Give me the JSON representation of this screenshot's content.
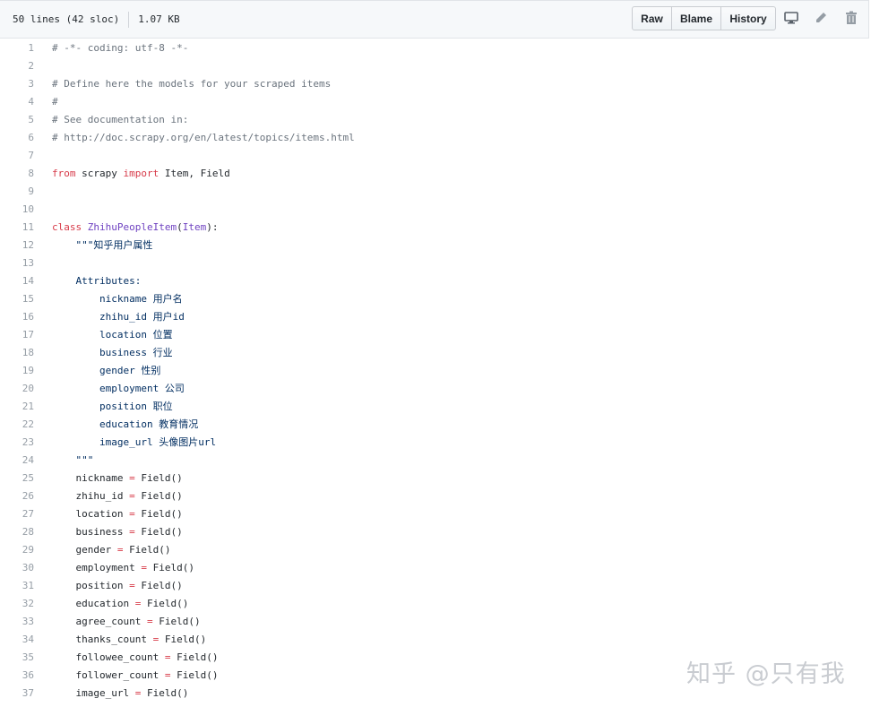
{
  "file_info": {
    "lines": "50 lines (42 sloc)",
    "size": "1.07 KB"
  },
  "buttons": {
    "raw": "Raw",
    "blame": "Blame",
    "history": "History"
  },
  "icons": {
    "desktop": "desktop-icon",
    "edit": "pencil-icon",
    "delete": "trash-icon"
  },
  "colors": {
    "comment": "#6a737d",
    "keyword": "#d73a49",
    "class": "#6f42c1",
    "builtin": "#005cc5",
    "line_number": "#959da5"
  },
  "watermark": "知乎 @只有我",
  "code_lines": [
    {
      "n": "1",
      "tokens": [
        {
          "t": "# -*- coding: utf-8 -*-",
          "c": "comment"
        }
      ]
    },
    {
      "n": "2",
      "tokens": []
    },
    {
      "n": "3",
      "tokens": [
        {
          "t": "# Define here the models for your scraped items",
          "c": "comment"
        }
      ]
    },
    {
      "n": "4",
      "tokens": [
        {
          "t": "#",
          "c": "comment"
        }
      ]
    },
    {
      "n": "5",
      "tokens": [
        {
          "t": "# See documentation in:",
          "c": "comment"
        }
      ]
    },
    {
      "n": "6",
      "tokens": [
        {
          "t": "# http://doc.scrapy.org/en/latest/topics/items.html",
          "c": "comment"
        }
      ]
    },
    {
      "n": "7",
      "tokens": []
    },
    {
      "n": "8",
      "tokens": [
        {
          "t": "from",
          "c": "keyword"
        },
        {
          "t": " scrapy ",
          "c": ""
        },
        {
          "t": "import",
          "c": "keyword"
        },
        {
          "t": " Item, Field",
          "c": ""
        }
      ]
    },
    {
      "n": "9",
      "tokens": []
    },
    {
      "n": "10",
      "tokens": []
    },
    {
      "n": "11",
      "tokens": [
        {
          "t": "class",
          "c": "keyword"
        },
        {
          "t": " ",
          "c": ""
        },
        {
          "t": "ZhihuPeopleItem",
          "c": "class"
        },
        {
          "t": "(",
          "c": ""
        },
        {
          "t": "Item",
          "c": "class"
        },
        {
          "t": "):",
          "c": ""
        }
      ]
    },
    {
      "n": "12",
      "tokens": [
        {
          "t": "    \"\"\"知乎用户属性",
          "c": "string"
        }
      ]
    },
    {
      "n": "13",
      "tokens": []
    },
    {
      "n": "14",
      "tokens": [
        {
          "t": "    Attributes:",
          "c": "string"
        }
      ]
    },
    {
      "n": "15",
      "tokens": [
        {
          "t": "        nickname 用户名",
          "c": "string"
        }
      ]
    },
    {
      "n": "16",
      "tokens": [
        {
          "t": "        zhihu_id 用户id",
          "c": "string"
        }
      ]
    },
    {
      "n": "17",
      "tokens": [
        {
          "t": "        location 位置",
          "c": "string"
        }
      ]
    },
    {
      "n": "18",
      "tokens": [
        {
          "t": "        business 行业",
          "c": "string"
        }
      ]
    },
    {
      "n": "19",
      "tokens": [
        {
          "t": "        gender 性别",
          "c": "string"
        }
      ]
    },
    {
      "n": "20",
      "tokens": [
        {
          "t": "        employment 公司",
          "c": "string"
        }
      ]
    },
    {
      "n": "21",
      "tokens": [
        {
          "t": "        position 职位",
          "c": "string"
        }
      ]
    },
    {
      "n": "22",
      "tokens": [
        {
          "t": "        education 教育情况",
          "c": "string"
        }
      ]
    },
    {
      "n": "23",
      "tokens": [
        {
          "t": "        image_url 头像图片url",
          "c": "string"
        }
      ]
    },
    {
      "n": "24",
      "tokens": [
        {
          "t": "    \"\"\"",
          "c": "string"
        }
      ]
    },
    {
      "n": "25",
      "tokens": [
        {
          "t": "    nickname ",
          "c": ""
        },
        {
          "t": "=",
          "c": "op"
        },
        {
          "t": " Field()",
          "c": ""
        }
      ]
    },
    {
      "n": "26",
      "tokens": [
        {
          "t": "    zhihu_id ",
          "c": ""
        },
        {
          "t": "=",
          "c": "op"
        },
        {
          "t": " Field()",
          "c": ""
        }
      ]
    },
    {
      "n": "27",
      "tokens": [
        {
          "t": "    location ",
          "c": ""
        },
        {
          "t": "=",
          "c": "op"
        },
        {
          "t": " Field()",
          "c": ""
        }
      ]
    },
    {
      "n": "28",
      "tokens": [
        {
          "t": "    business ",
          "c": ""
        },
        {
          "t": "=",
          "c": "op"
        },
        {
          "t": " Field()",
          "c": ""
        }
      ]
    },
    {
      "n": "29",
      "tokens": [
        {
          "t": "    gender ",
          "c": ""
        },
        {
          "t": "=",
          "c": "op"
        },
        {
          "t": " Field()",
          "c": ""
        }
      ]
    },
    {
      "n": "30",
      "tokens": [
        {
          "t": "    employment ",
          "c": ""
        },
        {
          "t": "=",
          "c": "op"
        },
        {
          "t": " Field()",
          "c": ""
        }
      ]
    },
    {
      "n": "31",
      "tokens": [
        {
          "t": "    position ",
          "c": ""
        },
        {
          "t": "=",
          "c": "op"
        },
        {
          "t": " Field()",
          "c": ""
        }
      ]
    },
    {
      "n": "32",
      "tokens": [
        {
          "t": "    education ",
          "c": ""
        },
        {
          "t": "=",
          "c": "op"
        },
        {
          "t": " Field()",
          "c": ""
        }
      ]
    },
    {
      "n": "33",
      "tokens": [
        {
          "t": "    agree_count ",
          "c": ""
        },
        {
          "t": "=",
          "c": "op"
        },
        {
          "t": " Field()",
          "c": ""
        }
      ]
    },
    {
      "n": "34",
      "tokens": [
        {
          "t": "    thanks_count ",
          "c": ""
        },
        {
          "t": "=",
          "c": "op"
        },
        {
          "t": " Field()",
          "c": ""
        }
      ]
    },
    {
      "n": "35",
      "tokens": [
        {
          "t": "    followee_count ",
          "c": ""
        },
        {
          "t": "=",
          "c": "op"
        },
        {
          "t": " Field()",
          "c": ""
        }
      ]
    },
    {
      "n": "36",
      "tokens": [
        {
          "t": "    follower_count ",
          "c": ""
        },
        {
          "t": "=",
          "c": "op"
        },
        {
          "t": " Field()",
          "c": ""
        }
      ]
    },
    {
      "n": "37",
      "tokens": [
        {
          "t": "    image_url ",
          "c": ""
        },
        {
          "t": "=",
          "c": "op"
        },
        {
          "t": " Field()",
          "c": ""
        }
      ]
    }
  ]
}
